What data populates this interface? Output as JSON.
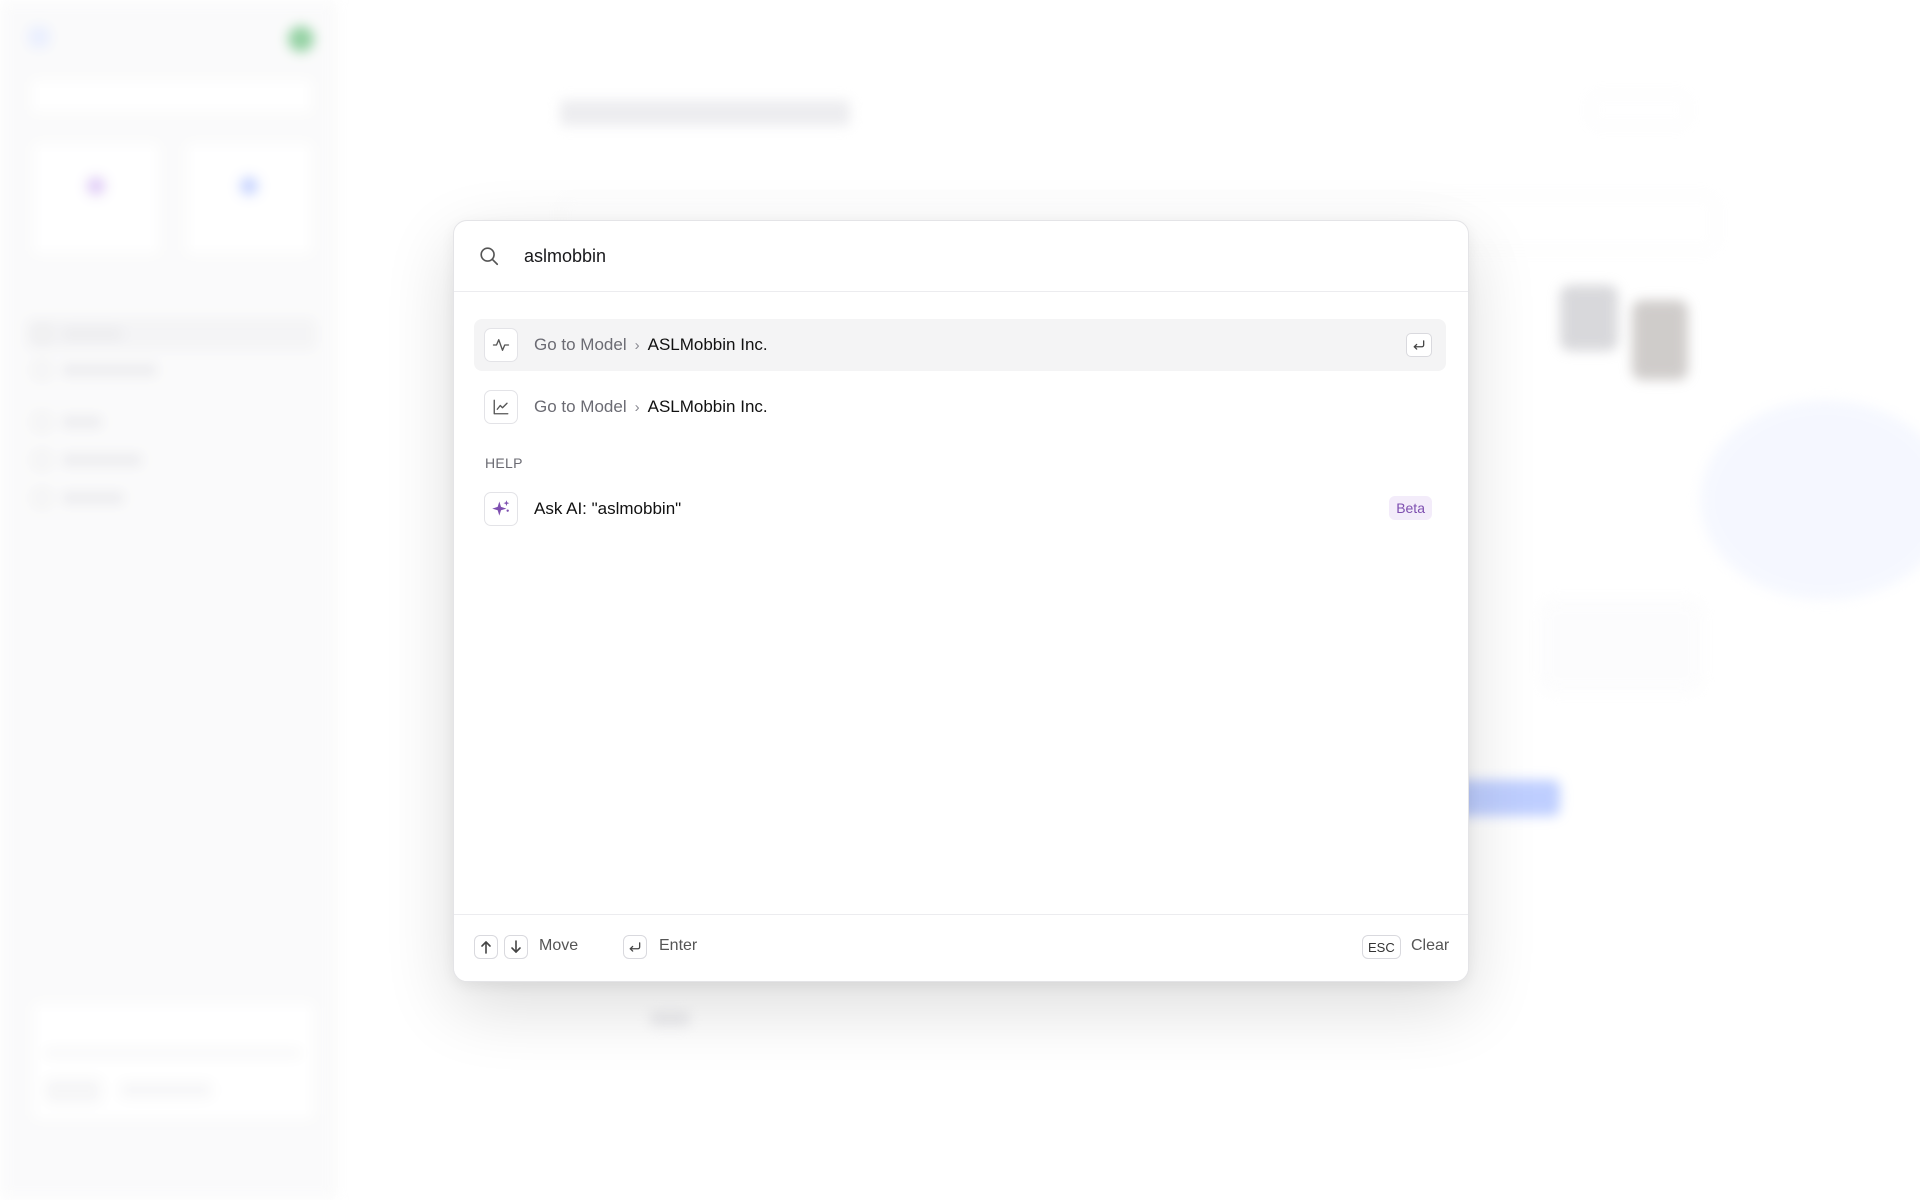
{
  "command_palette": {
    "query": "aslmobbin",
    "results": [
      {
        "prefix": "Go to Model",
        "target": "ASLMobbin Inc.",
        "icon": "activity-icon",
        "selected": true
      },
      {
        "prefix": "Go to Model",
        "target": "ASLMobbin Inc.",
        "icon": "line-chart-icon",
        "selected": false
      }
    ],
    "help_section": {
      "label": "HELP",
      "ask_ai_label": "Ask AI: \"aslmobbin\"",
      "badge": "Beta",
      "icon": "sparkles-icon"
    },
    "footer": {
      "move_label": "Move",
      "enter_label": "Enter",
      "esc_key": "ESC",
      "clear_label": "Clear"
    }
  },
  "colors": {
    "accent_purple": "#7e4fb0",
    "beta_bg": "#f3ecfa",
    "selected_row_bg": "#f4f4f5",
    "text_muted": "#6b6b73"
  }
}
